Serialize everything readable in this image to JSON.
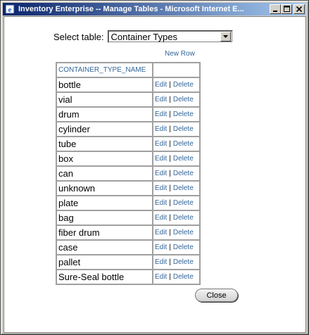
{
  "window": {
    "title": "Inventory Enterprise -- Manage Tables - Microsoft Internet E..."
  },
  "form": {
    "select_label": "Select table:",
    "selected_table": "Container Types",
    "new_row_label": "New Row"
  },
  "table": {
    "column_header": "CONTAINER_TYPE_NAME",
    "edit_label": "Edit",
    "separator": "|",
    "delete_label": "Delete",
    "rows": [
      {
        "name": "bottle"
      },
      {
        "name": "vial"
      },
      {
        "name": "drum"
      },
      {
        "name": "cylinder"
      },
      {
        "name": "tube"
      },
      {
        "name": "box"
      },
      {
        "name": "can"
      },
      {
        "name": "unknown"
      },
      {
        "name": "plate"
      },
      {
        "name": "bag"
      },
      {
        "name": "fiber drum"
      },
      {
        "name": "case"
      },
      {
        "name": "pallet"
      },
      {
        "name": "Sure-Seal bottle"
      }
    ]
  },
  "footer": {
    "close_label": "Close"
  }
}
